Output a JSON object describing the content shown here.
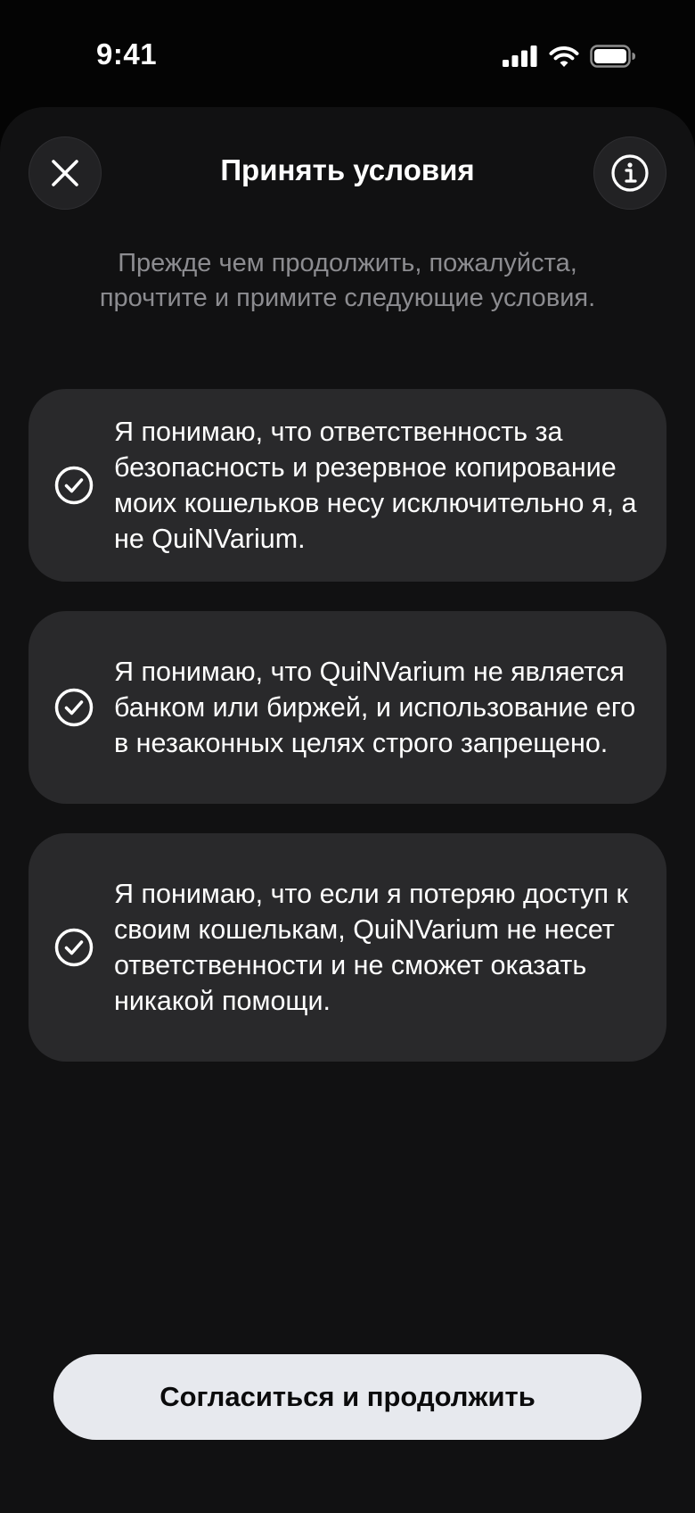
{
  "status_bar": {
    "time": "9:41",
    "icons": [
      "signal-icon",
      "wifi-icon",
      "battery-icon"
    ]
  },
  "header": {
    "title": "Принять условия",
    "close_icon": "close-icon",
    "info_icon": "info-icon"
  },
  "intro": {
    "text": "Прежде чем продолжить, пожалуйста, прочтите и примите следующие условия."
  },
  "terms": [
    {
      "icon": "check-circle-icon",
      "text": "Я понимаю, что ответственность за безопасность и резервное копирование моих кошельков несу исключительно я, а не QuiNVarium."
    },
    {
      "icon": "check-circle-icon",
      "text": "Я понимаю, что QuiNVarium не является банком или биржей, и использование его в незаконных целях строго запрещено."
    },
    {
      "icon": "check-circle-icon",
      "text": "Я понимаю, что если я потеряю доступ к своим кошелькам, QuiNVarium не несет ответственности и не сможет оказать никакой помощи."
    }
  ],
  "footer": {
    "primary_button_label": "Согласиться и продолжить"
  },
  "colors": {
    "background": "#040404",
    "sheet": "#111112",
    "card": "#29292b",
    "muted_text": "#8c8c90",
    "button_bg": "#e7e9ee",
    "button_text": "#0b0b0c"
  }
}
